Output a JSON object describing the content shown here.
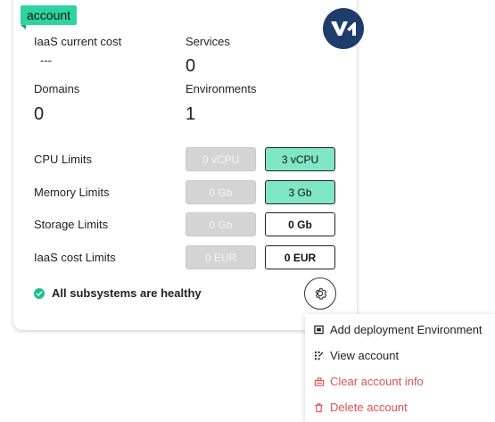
{
  "card": {
    "tag": "account",
    "stats": {
      "iaas_label": "IaaS current cost",
      "iaas_value": "---",
      "services_label": "Services",
      "services_value": "0",
      "domains_label": "Domains",
      "domains_value": "0",
      "environments_label": "Environments",
      "environments_value": "1"
    },
    "limits": [
      {
        "label": "CPU Limits",
        "current": "0 vCPU",
        "limit": "3 vCPU"
      },
      {
        "label": "Memory Limits",
        "current": "0 Gb",
        "limit": "3 Gb"
      },
      {
        "label": "Storage Limits",
        "current": "0 Gb",
        "limit": "0 Gb"
      },
      {
        "label": "IaaS cost Limits",
        "current": "0 EUR",
        "limit": "0 EUR"
      }
    ],
    "status_text": "All subsystems are healthy"
  },
  "menu": {
    "items": [
      {
        "label": "Add deployment Environment",
        "icon": "environment-icon"
      },
      {
        "label": "View account",
        "icon": "view-icon"
      },
      {
        "label": "Clear account info",
        "icon": "clear-icon"
      },
      {
        "label": "Delete account",
        "icon": "trash-icon"
      }
    ]
  },
  "colors": {
    "accent": "#2dd4a1",
    "logo_bg": "#1e3d6b",
    "limit_green": "#7fe6c6",
    "limit_grey": "#d4d4d4",
    "danger": "#e05050",
    "healthy": "#1fbf8f"
  }
}
